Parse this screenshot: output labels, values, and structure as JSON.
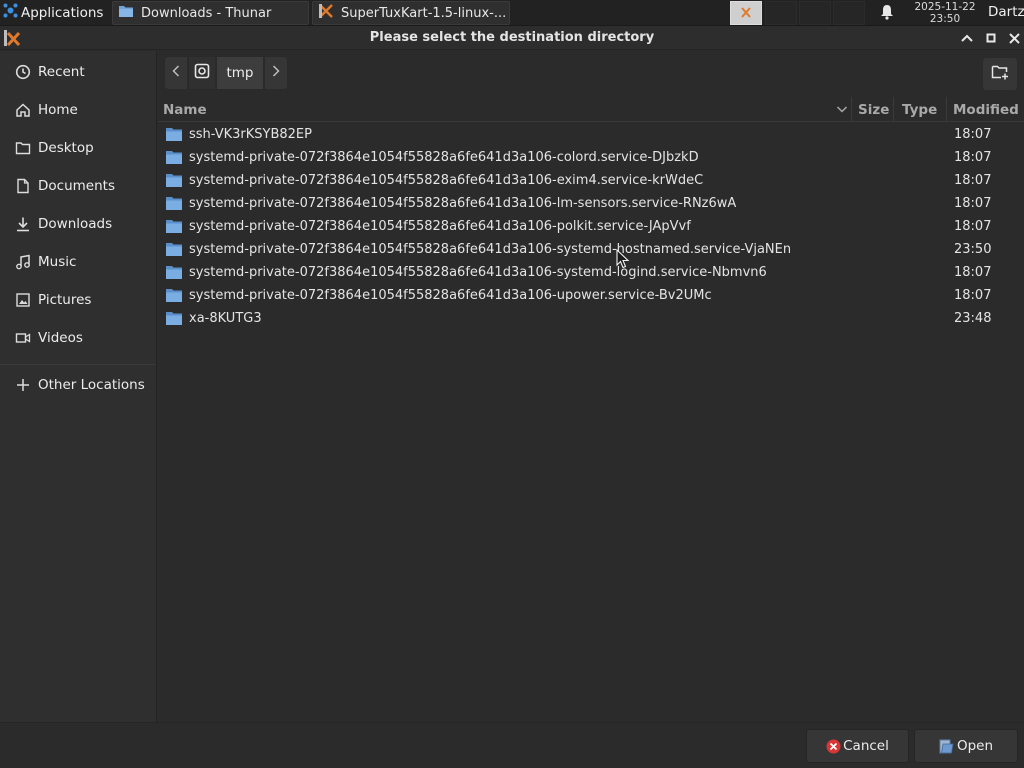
{
  "taskbar": {
    "applications_label": "Applications",
    "tasks": [
      {
        "label": "Downloads - Thunar",
        "icon": "folder-icon"
      },
      {
        "label": "SuperTuxKart-1.5-linux-...",
        "icon": "installer-icon"
      }
    ],
    "clock": {
      "date": "2025-11-22",
      "time": "23:50"
    },
    "user": "Dartz"
  },
  "dialog": {
    "title": "Please select the destination directory"
  },
  "sidebar": {
    "items": [
      {
        "label": "Recent",
        "icon": "clock-icon"
      },
      {
        "label": "Home",
        "icon": "home-icon"
      },
      {
        "label": "Desktop",
        "icon": "folder-icon"
      },
      {
        "label": "Documents",
        "icon": "document-icon"
      },
      {
        "label": "Downloads",
        "icon": "download-icon"
      },
      {
        "label": "Music",
        "icon": "music-icon"
      },
      {
        "label": "Pictures",
        "icon": "picture-icon"
      },
      {
        "label": "Videos",
        "icon": "video-icon"
      },
      {
        "label": "Other Locations",
        "icon": "plus-icon"
      }
    ]
  },
  "pathbar": {
    "current": "tmp"
  },
  "list": {
    "columns": {
      "name": "Name",
      "size": "Size",
      "type": "Type",
      "modified": "Modified"
    },
    "rows": [
      {
        "name": "ssh-VK3rKSYB82EP",
        "modified": "18:07"
      },
      {
        "name": "systemd-private-072f3864e1054f55828a6fe641d3a106-colord.service-DJbzkD",
        "modified": "18:07"
      },
      {
        "name": "systemd-private-072f3864e1054f55828a6fe641d3a106-exim4.service-krWdeC",
        "modified": "18:07"
      },
      {
        "name": "systemd-private-072f3864e1054f55828a6fe641d3a106-lm-sensors.service-RNz6wA",
        "modified": "18:07"
      },
      {
        "name": "systemd-private-072f3864e1054f55828a6fe641d3a106-polkit.service-JApVvf",
        "modified": "18:07"
      },
      {
        "name": "systemd-private-072f3864e1054f55828a6fe641d3a106-systemd-hostnamed.service-VjaNEn",
        "modified": "23:50"
      },
      {
        "name": "systemd-private-072f3864e1054f55828a6fe641d3a106-systemd-logind.service-Nbmvn6",
        "modified": "18:07"
      },
      {
        "name": "systemd-private-072f3864e1054f55828a6fe641d3a106-upower.service-Bv2UMc",
        "modified": "18:07"
      },
      {
        "name": "xa-8KUTG3",
        "modified": "23:48"
      }
    ]
  },
  "footer": {
    "cancel_label": "Cancel",
    "open_label": "Open"
  },
  "colors": {
    "background": "#2b2b2b",
    "sidebar": "#2f2f2f",
    "folder": "#6fa3dc",
    "cancel_icon": "#d93636"
  }
}
